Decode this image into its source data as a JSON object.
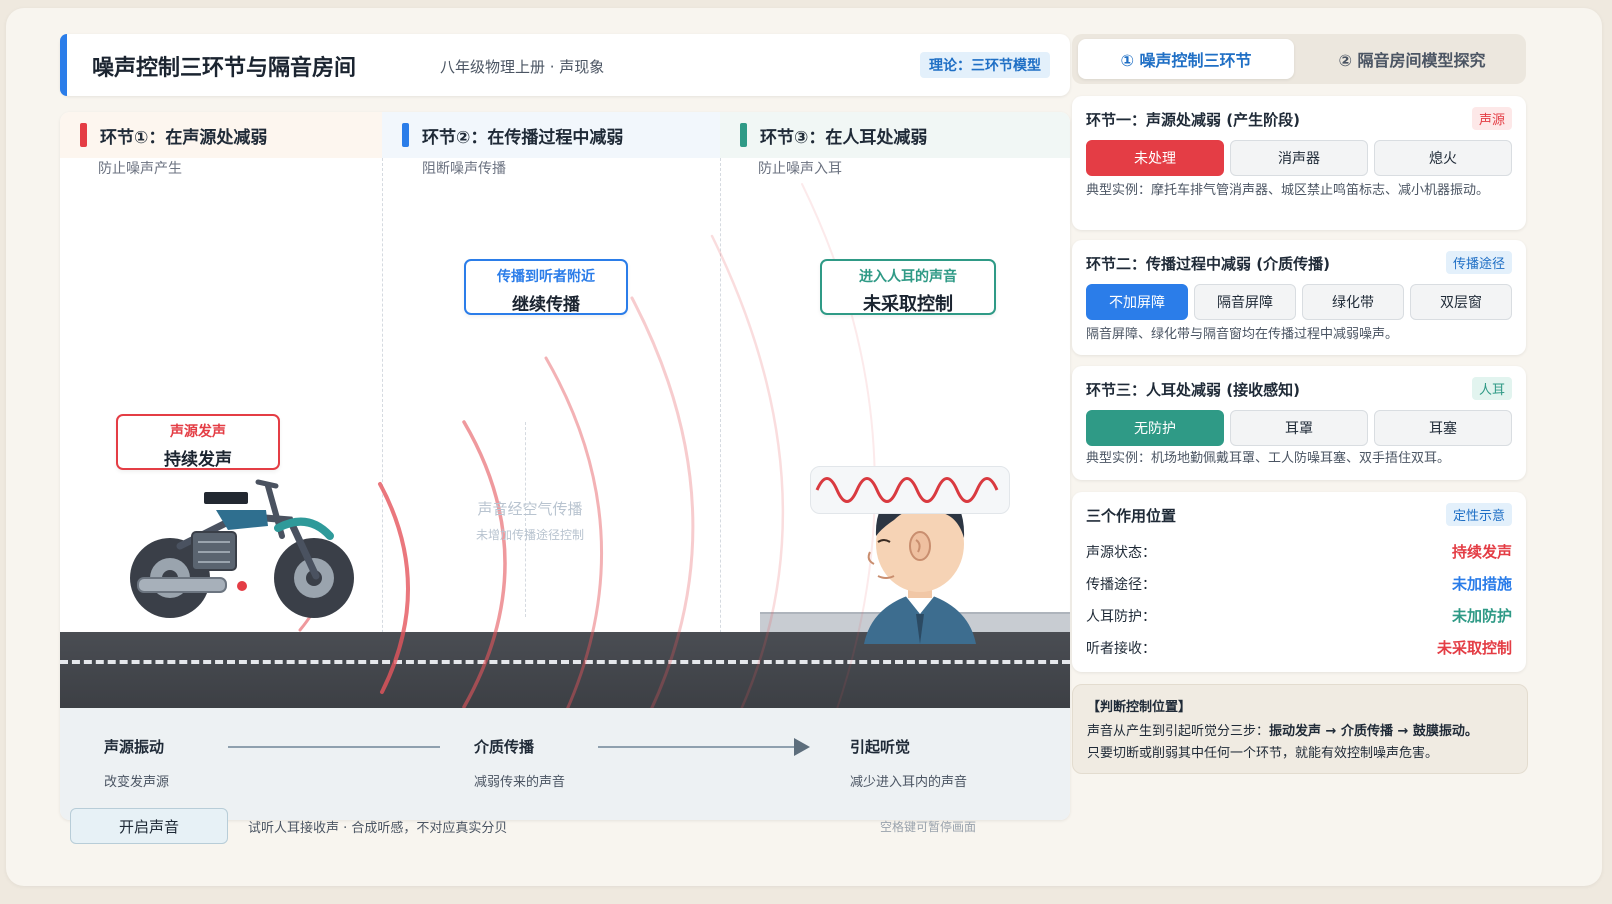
{
  "header": {
    "title": "噪声控制三环节与隔音房间",
    "subtitle": "八年级物理上册 · 声现象",
    "badge": "理论：三环节模型"
  },
  "stage": {
    "columns": [
      {
        "title": "环节①：在声源处减弱",
        "sub": "防止噪声产生",
        "color": "#e43d45"
      },
      {
        "title": "环节②：在传播过程中减弱",
        "sub": "阻断噪声传播",
        "color": "#2b7de9"
      },
      {
        "title": "环节③：在人耳处减弱",
        "sub": "防止噪声入耳",
        "color": "#2f9a86"
      }
    ],
    "source_callout": {
      "small": "声源发声",
      "big": "持续发声"
    },
    "propagate_callout": {
      "small": "传播到听者附近",
      "big": "继续传播"
    },
    "ear_callout": {
      "small": "进入人耳的声音",
      "big": "未采取控制"
    },
    "air_label": "声音经空气传播",
    "air_sub": "未增加传播途径控制"
  },
  "flow": [
    {
      "title": "声源振动",
      "desc": "改变发声源"
    },
    {
      "title": "介质传播",
      "desc": "减弱传来的声音"
    },
    {
      "title": "引起听觉",
      "desc": "减少进入耳内的声音"
    }
  ],
  "bottom": {
    "sound_button": "开启声音",
    "sound_note": "试听人耳接收声 · 合成听感，不对应真实分贝",
    "space_hint": "空格键可暂停画面"
  },
  "tabs": [
    {
      "label": "① 噪声控制三环节",
      "active": true
    },
    {
      "label": "② 隔音房间模型探究",
      "active": false
    }
  ],
  "cards": {
    "source": {
      "title": "环节一：声源处减弱 (产生阶段)",
      "tag": "声源",
      "options": [
        "未处理",
        "消声器",
        "熄火"
      ],
      "selected": "未处理",
      "note": "典型实例：摩托车排气管消声器、城区禁止鸣笛标志、减小机器振动。"
    },
    "path": {
      "title": "环节二：传播过程中减弱 (介质传播)",
      "tag": "传播途径",
      "options": [
        "不加屏障",
        "隔音屏障",
        "绿化带",
        "双层窗"
      ],
      "selected": "不加屏障",
      "note": "隔音屏障、绿化带与隔音窗均在传播过程中减弱噪声。"
    },
    "ear": {
      "title": "环节三：人耳处减弱 (接收感知)",
      "tag": "人耳",
      "options": [
        "无防护",
        "耳罩",
        "耳塞"
      ],
      "selected": "无防护",
      "note": "典型实例：机场地勤佩戴耳罩、工人防噪耳塞、双手捂住双耳。"
    },
    "positions": {
      "title": "三个作用位置",
      "tag": "定性示意",
      "rows": [
        {
          "k": "声源状态：",
          "v": "持续发声",
          "color": "#e43d45"
        },
        {
          "k": "传播途径：",
          "v": "未加措施",
          "color": "#2b7de9"
        },
        {
          "k": "人耳防护：",
          "v": "未加防护",
          "color": "#2f9a86"
        },
        {
          "k": "听者接收：",
          "v": "未采取控制",
          "color": "#e43d45"
        }
      ]
    }
  },
  "judge": {
    "title": "【判断控制位置】",
    "line1_prefix": "声音从产生到引起听觉分三步：",
    "line1_bold": "振动发声 → 介质传播 → 鼓膜振动。",
    "line2": "只要切断或削弱其中任何一个环节，就能有效控制噪声危害。"
  }
}
